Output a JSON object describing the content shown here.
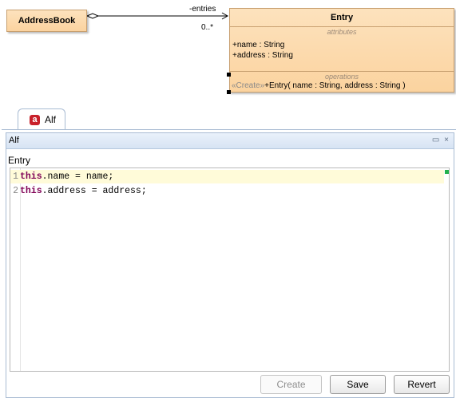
{
  "diagram": {
    "address_book": {
      "name": "AddressBook"
    },
    "association": {
      "role": "-entries",
      "multiplicity": "0..*"
    },
    "entry_class": {
      "name": "Entry",
      "attributes_title": "attributes",
      "attributes": [
        "+name : String",
        "+address : String"
      ],
      "operations_title": "operations",
      "operation_stereotype": "«Create»",
      "operation_signature": "+Entry( name : String, address : String )"
    }
  },
  "tab": {
    "label": "Alf",
    "icon": "alf-icon"
  },
  "view": {
    "title": "Alf",
    "actions": {
      "minimize": "▭",
      "close": "×"
    },
    "element_name": "Entry"
  },
  "editor": {
    "lines": [
      {
        "num": "1",
        "keyword": "this",
        "rest": ".name = name;"
      },
      {
        "num": "2",
        "keyword": "this",
        "rest": ".address = address;"
      }
    ]
  },
  "buttons": {
    "create": "Create",
    "save": "Save",
    "revert": "Revert"
  }
}
